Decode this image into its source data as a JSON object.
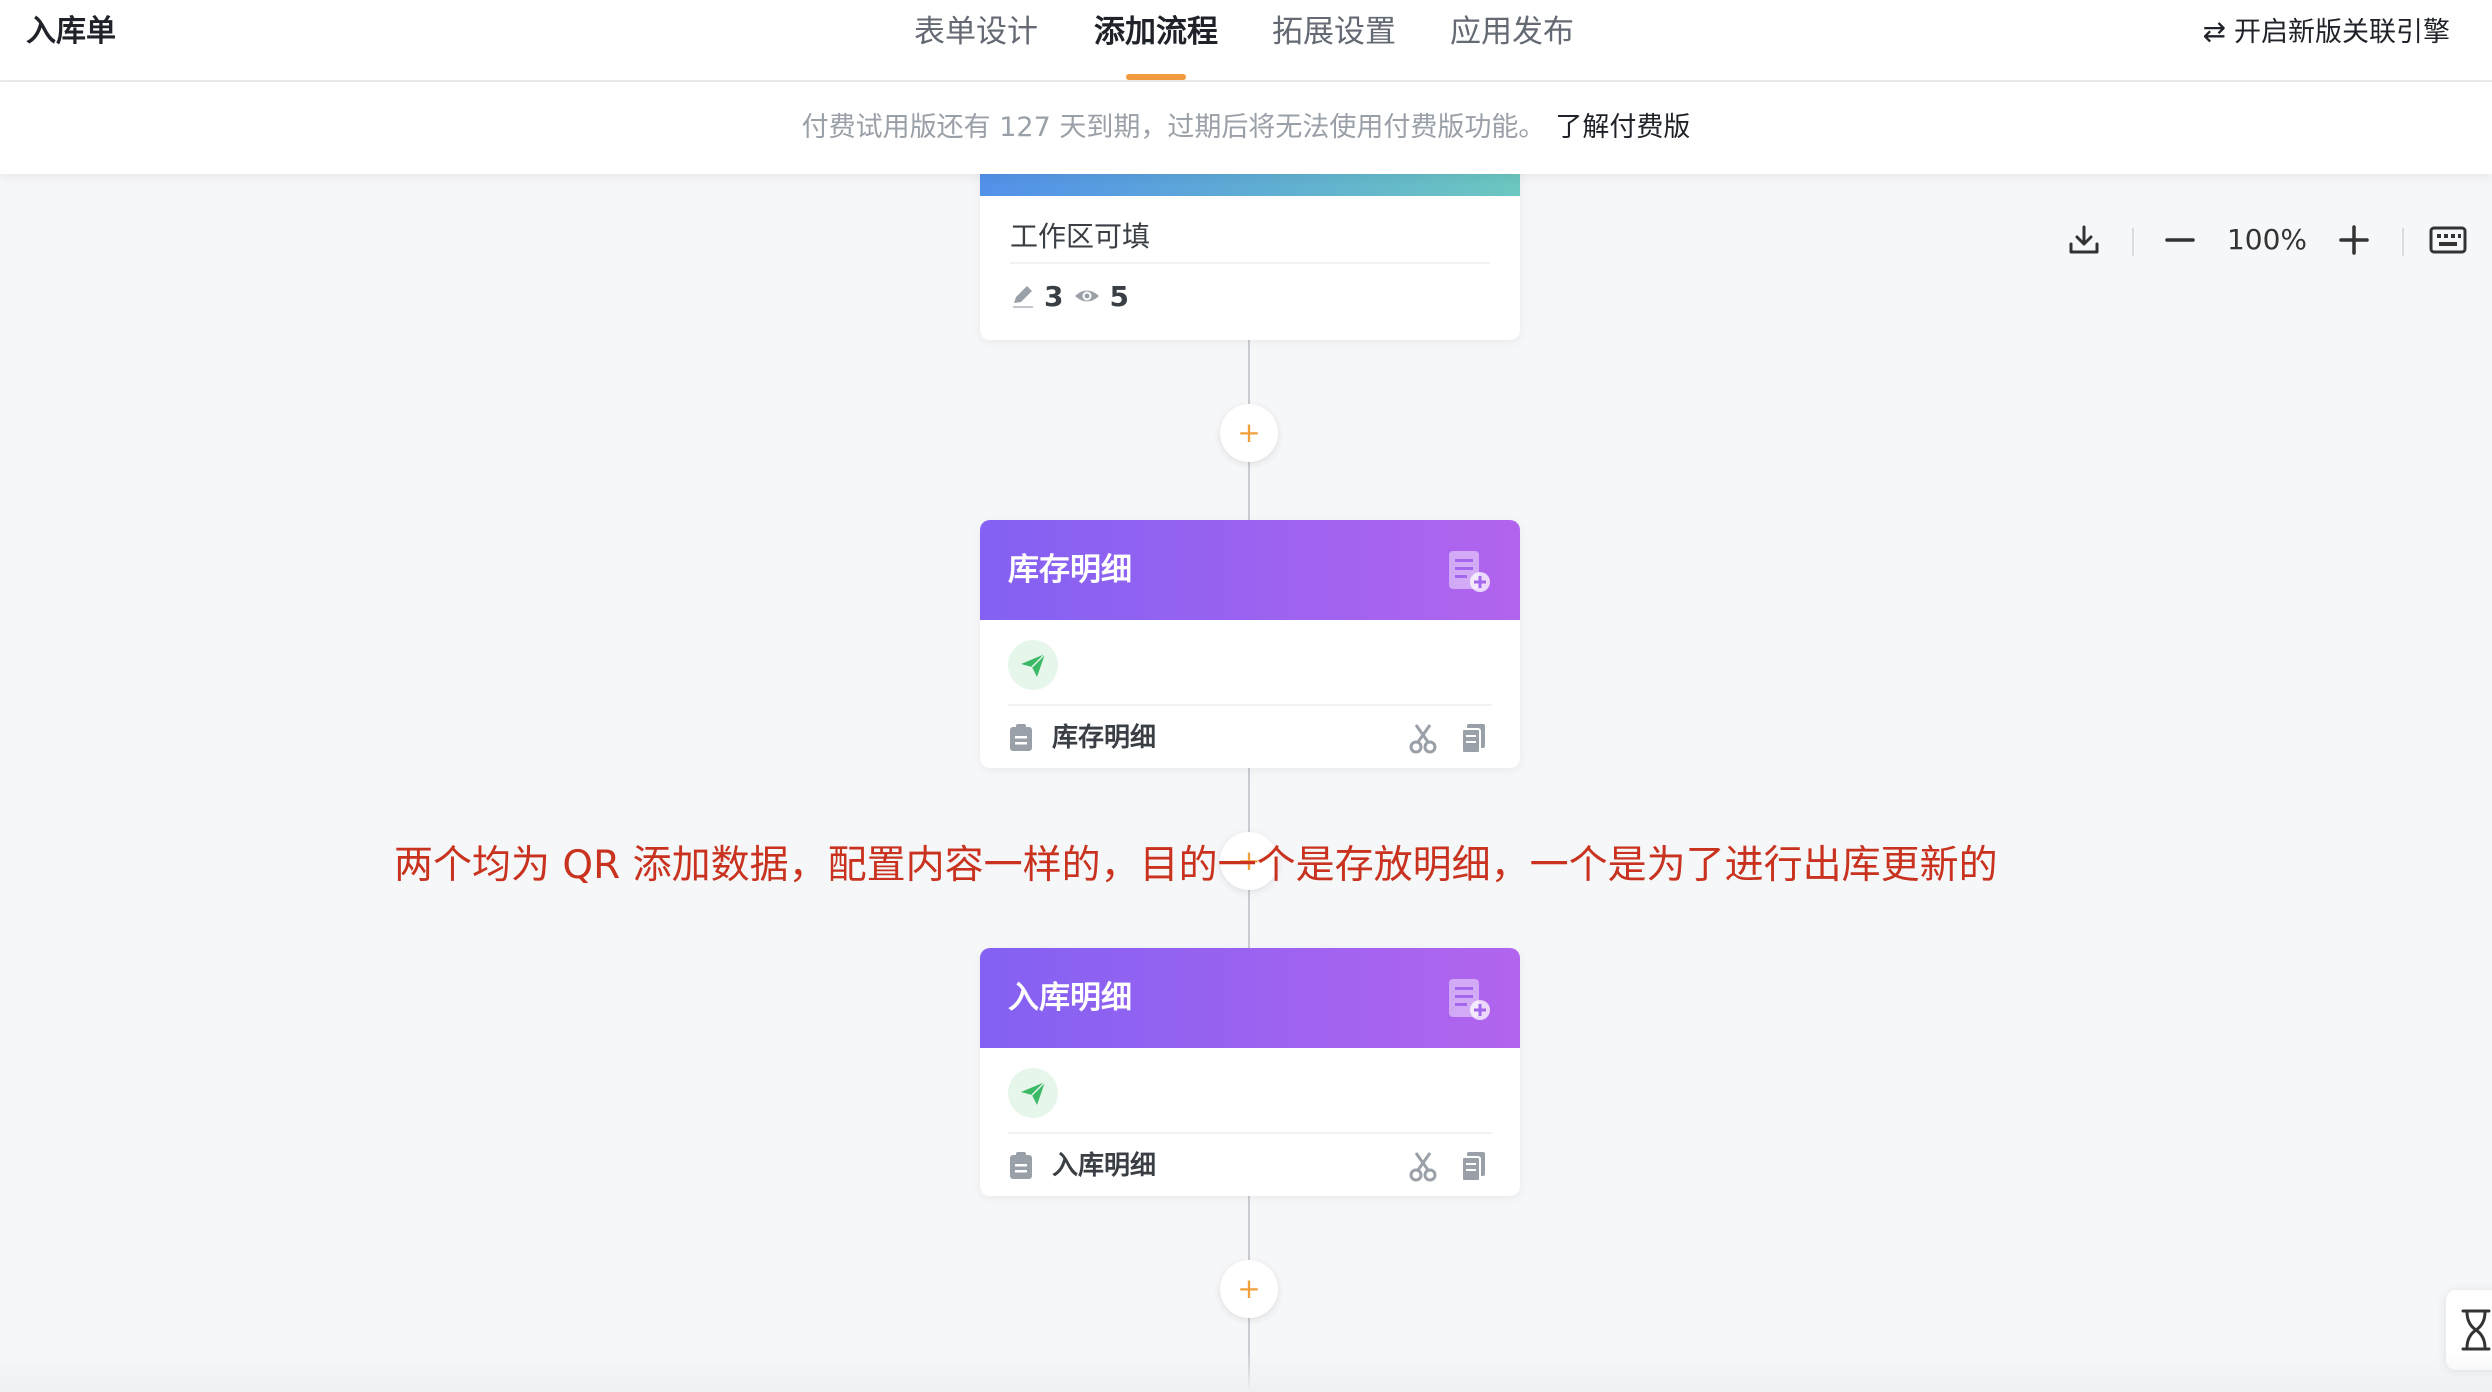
{
  "app": {
    "title": "入库单"
  },
  "tabs": [
    {
      "label": "表单设计",
      "active": false
    },
    {
      "label": "添加流程",
      "active": true
    },
    {
      "label": "拓展设置",
      "active": false
    },
    {
      "label": "应用发布",
      "active": false
    }
  ],
  "engine_link": {
    "icon": "swap-icon",
    "label": "开启新版关联引擎"
  },
  "banner": {
    "text": "付费试用版还有 127 天到期，过期后将无法使用付费版功能。",
    "link": "了解付费版"
  },
  "zoom": {
    "level": "100%",
    "icons": [
      "download-icon",
      "zoom-out-icon",
      "zoom-in-icon",
      "keyboard-icon"
    ]
  },
  "top_card": {
    "label": "工作区可填",
    "edit_count": "3",
    "view_count": "5"
  },
  "nodes": [
    {
      "title": "库存明细",
      "row_label": "库存明细"
    },
    {
      "title": "入库明细",
      "row_label": "入库明细"
    }
  ],
  "annotation": "两个均为 QR 添加数据，配置内容一样的，目的一个是存放明细，一个是为了进行出库更新的",
  "add_button": {
    "symbol": "+"
  },
  "colors": {
    "accent": "#f19a3e",
    "node_header_start": "#8361f2",
    "node_header_end": "#b264ee",
    "annotation": "#c8321e"
  }
}
